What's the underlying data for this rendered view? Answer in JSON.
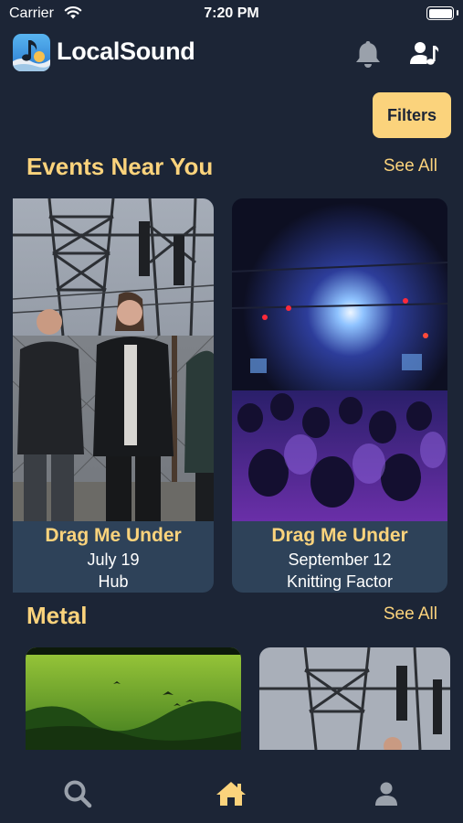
{
  "status_bar": {
    "carrier": "Carrier",
    "time": "7:20 PM"
  },
  "header": {
    "app_name": "LocalSound",
    "logo_icon": "music-note-icon",
    "bell_icon": "bell-icon",
    "profile_icon": "user-music-icon"
  },
  "filters": {
    "label": "Filters"
  },
  "sections": {
    "events": {
      "title": "Events Near You",
      "see_all": "See All",
      "cards": [
        {
          "name": "Drag Me Under",
          "date": "July 19",
          "venue": "Hub"
        },
        {
          "name": "Drag Me Under",
          "date": "September 12",
          "venue": "Knitting Factor"
        }
      ]
    },
    "metal": {
      "title": "Metal",
      "see_all": "See All"
    }
  },
  "tab_bar": {
    "items": [
      {
        "icon": "search-icon",
        "active": false
      },
      {
        "icon": "home-icon",
        "active": true
      },
      {
        "icon": "person-icon",
        "active": false
      }
    ]
  },
  "colors": {
    "background": "#1c2536",
    "accent": "#fbd37c",
    "card": "#2e4259",
    "icon_muted": "#9aa1ab"
  }
}
